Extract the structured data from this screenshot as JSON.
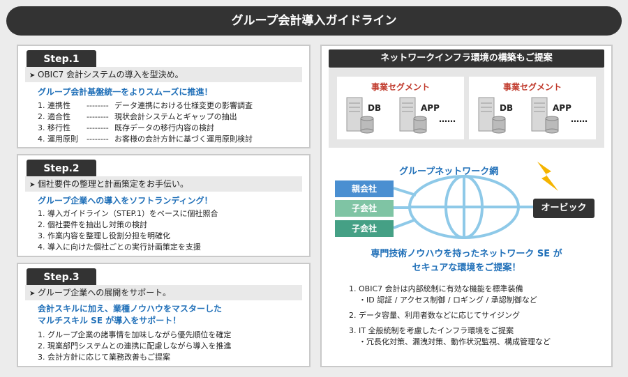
{
  "title": "グループ会計導入ガイドライン",
  "steps": [
    {
      "tab": "Step.1",
      "head": "OBIC7 会計システムの導入を型決め。",
      "sub": [
        "グループ会計基盤統一をよりスムーズに推進！"
      ],
      "items": [
        {
          "term": "1. 連携性",
          "dash": "--------",
          "desc": "データ連携における仕様変更の影響調査"
        },
        {
          "term": "2. 適合性",
          "dash": "--------",
          "desc": "現状会計システムとギャップの抽出"
        },
        {
          "term": "3. 移行性",
          "dash": "--------",
          "desc": "既存データの移行内容の検討"
        },
        {
          "term": "4. 運用原則",
          "dash": "--------",
          "desc": "お客様の会計方針に基づく運用原則検討"
        }
      ]
    },
    {
      "tab": "Step.2",
      "head": "個社要件の整理と計画策定をお手伝い。",
      "sub": [
        "グループ企業への導入をソフトランディング！"
      ],
      "items": [
        "1. 導入ガイドライン（STEP.1）をベースに個社照合",
        "2. 個社要件を抽出し対策の検討",
        "3. 作業内容を整理し役割分担を明確化",
        "4. 導入に向けた個社ごとの実行計画策定を支援"
      ]
    },
    {
      "tab": "Step.3",
      "head": "グループ企業への展開をサポート。",
      "sub": [
        "会計スキルに加え、業種ノウハウをマスターした",
        "マルチスキル SE が導入をサポート！"
      ],
      "items": [
        "1. グループ企業の諸事情を加味しながら優先順位を確定",
        "2. 現業部門システムとの連携に配慮しながら導入を推進",
        "3. 会計方針に応じて業務改善もご提案"
      ]
    }
  ],
  "right": {
    "head": "ネットワークインフラ環境の構築もご提案",
    "segments": [
      {
        "title": "事業セグメント",
        "db": "DB",
        "app": "APP",
        "more": "……"
      },
      {
        "title": "事業セグメント",
        "db": "DB",
        "app": "APP",
        "more": "……"
      }
    ],
    "network_title": "グループネットワーク網",
    "companies": [
      {
        "label": "親会社",
        "color": "#4a8fd1"
      },
      {
        "label": "子会社",
        "color": "#7fc4a4"
      },
      {
        "label": "子会社",
        "color": "#45a085"
      }
    ],
    "obic": "オービック",
    "se_title": [
      "専門技術ノウハウを持ったネットワーク SE が",
      "セキュアな環境をご提案！"
    ],
    "points": [
      {
        "main": "1. OBIC7 会計は内部統制に有効な機能を標準装備",
        "sub": "・ID 認証 / アクセス制御 / ロギング / 承認制御など"
      },
      {
        "main": "2. データ容量、利用者数などに応じてサイジング",
        "sub": ""
      },
      {
        "main": "3. IT 全般統制を考慮したインフラ環境をご提案",
        "sub": "・冗長化対策、漏洩対策、動作状況監視、構成管理など"
      }
    ]
  }
}
